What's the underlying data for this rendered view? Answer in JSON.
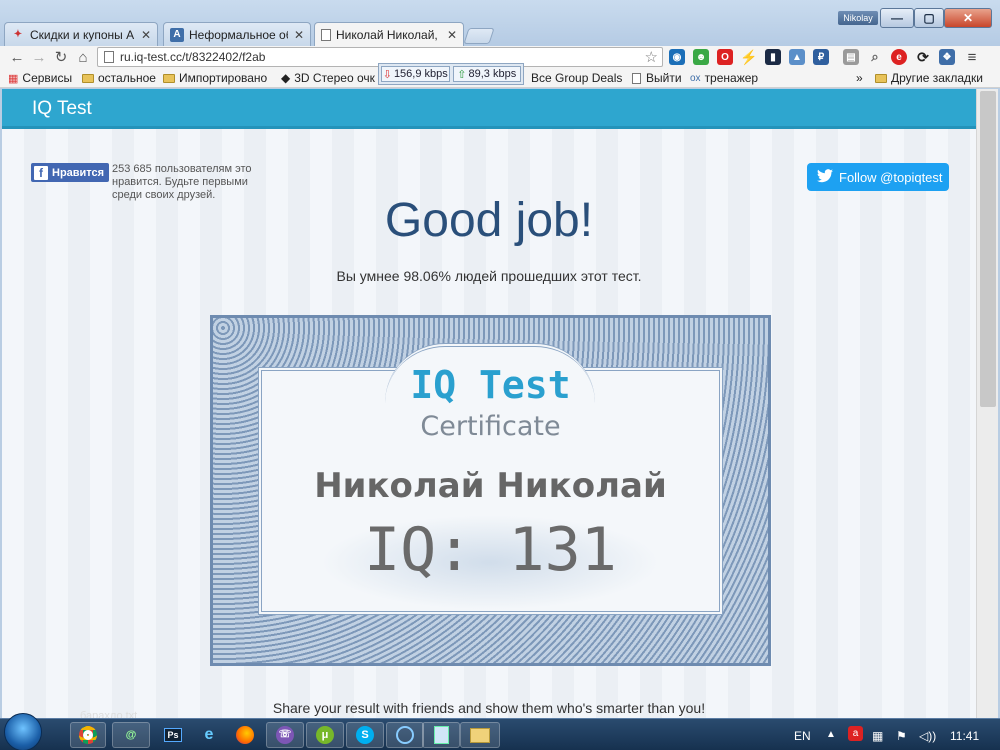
{
  "browser": {
    "tabs": [
      {
        "label": "Скидки и купоны А",
        "icon": "puzzle-icon",
        "active": false
      },
      {
        "label": "Неформальное общ",
        "icon": "a-letter-icon",
        "active": false
      },
      {
        "label": "Николай Николай, В",
        "icon": "page-icon",
        "active": true
      }
    ],
    "profile_name": "Nikolay",
    "url": "ru.iq-test.cc/t/8322402/f2ab",
    "speed_down": "156,9 kbps",
    "speed_up": "89,3 kbps",
    "bookmarks": [
      {
        "label": "Сервисы",
        "type": "apps"
      },
      {
        "label": "остальное",
        "type": "folder"
      },
      {
        "label": "Импортировано",
        "type": "folder"
      },
      {
        "label": "3D Стерео очк",
        "type": "link"
      },
      {
        "label": "Все Group Deals",
        "type": "link"
      },
      {
        "label": "Выйти",
        "type": "page"
      },
      {
        "label": "тренажер",
        "type": "link"
      }
    ],
    "other_bookmarks": "Другие закладки",
    "overflow": "»"
  },
  "site": {
    "brand": "IQ Test",
    "fb_like": "Нравится",
    "fb_count_text": "253 685 пользователям это нравится. Будьте первыми среди своих друзей.",
    "twitter_follow": "Follow @topiqtest",
    "headline": "Good job!",
    "result_line": "Вы умнее 98.06% людей прошедших этот тест.",
    "share_line": "Share your result with friends and show them who's smarter than you!"
  },
  "certificate": {
    "title": "IQ Test",
    "subtitle": "Certificate",
    "name": "Николай Николай",
    "score": "IQ: 131",
    "score_value": 131,
    "percentile": 98.06
  },
  "taskbar": {
    "floating_label": "барахло.txt",
    "language": "EN",
    "clock": "11:41"
  },
  "colors": {
    "navbar": "#2ea6cf",
    "headline": "#2a4f7a",
    "cert_title": "#2aa0cf",
    "facebook": "#4267b2",
    "twitter": "#1da1f2"
  }
}
